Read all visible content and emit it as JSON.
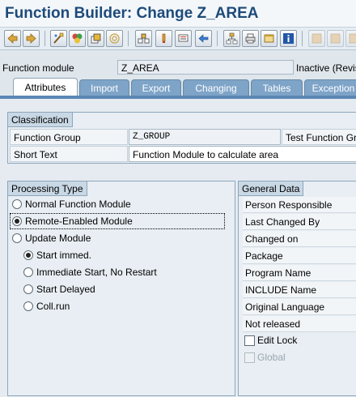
{
  "window": {
    "title": "Function Builder: Change Z_AREA"
  },
  "toolbar": {
    "buttons": [
      {
        "icon": "back-arrow-icon"
      },
      {
        "icon": "forward-arrow-icon"
      },
      {
        "icon": "other-object-icon"
      },
      {
        "icon": "check-icon"
      },
      {
        "icon": "activate-icon"
      },
      {
        "icon": "test-icon"
      },
      {
        "icon": "where-used-icon"
      },
      {
        "icon": "pointer-icon"
      },
      {
        "icon": "display-object-list-icon"
      },
      {
        "icon": "navigate-icon"
      },
      {
        "icon": "hierarchy-icon"
      },
      {
        "icon": "print-icon"
      },
      {
        "icon": "window-icon"
      },
      {
        "icon": "info-icon"
      },
      {
        "icon": "disabled-icon-1"
      },
      {
        "icon": "disabled-icon-2"
      },
      {
        "icon": "disabled-icon-3"
      }
    ]
  },
  "header": {
    "function_module_label": "Function module",
    "function_module_value": "Z_AREA",
    "status": "Inactive (Revis"
  },
  "tabs": [
    {
      "label": "Attributes",
      "active": true
    },
    {
      "label": "Import",
      "active": false
    },
    {
      "label": "Export",
      "active": false
    },
    {
      "label": "Changing",
      "active": false
    },
    {
      "label": "Tables",
      "active": false
    },
    {
      "label": "Exception",
      "active": false
    }
  ],
  "classification": {
    "title": "Classification",
    "function_group_label": "Function Group",
    "function_group_value": "Z_GROUP",
    "function_group_text": "Test Function Gr",
    "short_text_label": "Short Text",
    "short_text_value": "Function Module to calculate area"
  },
  "processing_type": {
    "title": "Processing Type",
    "options": [
      {
        "label": "Normal Function Module",
        "checked": false
      },
      {
        "label": "Remote-Enabled Module",
        "checked": true
      },
      {
        "label": "Update Module",
        "checked": false
      }
    ],
    "update_options": [
      {
        "label": "Start immed.",
        "checked": true
      },
      {
        "label": "Immediate Start, No Restart",
        "checked": false
      },
      {
        "label": "Start Delayed",
        "checked": false
      },
      {
        "label": "Coll.run",
        "checked": false
      }
    ]
  },
  "general_data": {
    "title": "General Data",
    "fields": [
      "Person Responsible",
      "Last Changed By",
      "Changed on",
      "Package",
      "Program Name",
      "INCLUDE Name",
      "Original Language",
      "Not released"
    ],
    "edit_lock_label": "Edit Lock",
    "global_label": "Global"
  }
}
